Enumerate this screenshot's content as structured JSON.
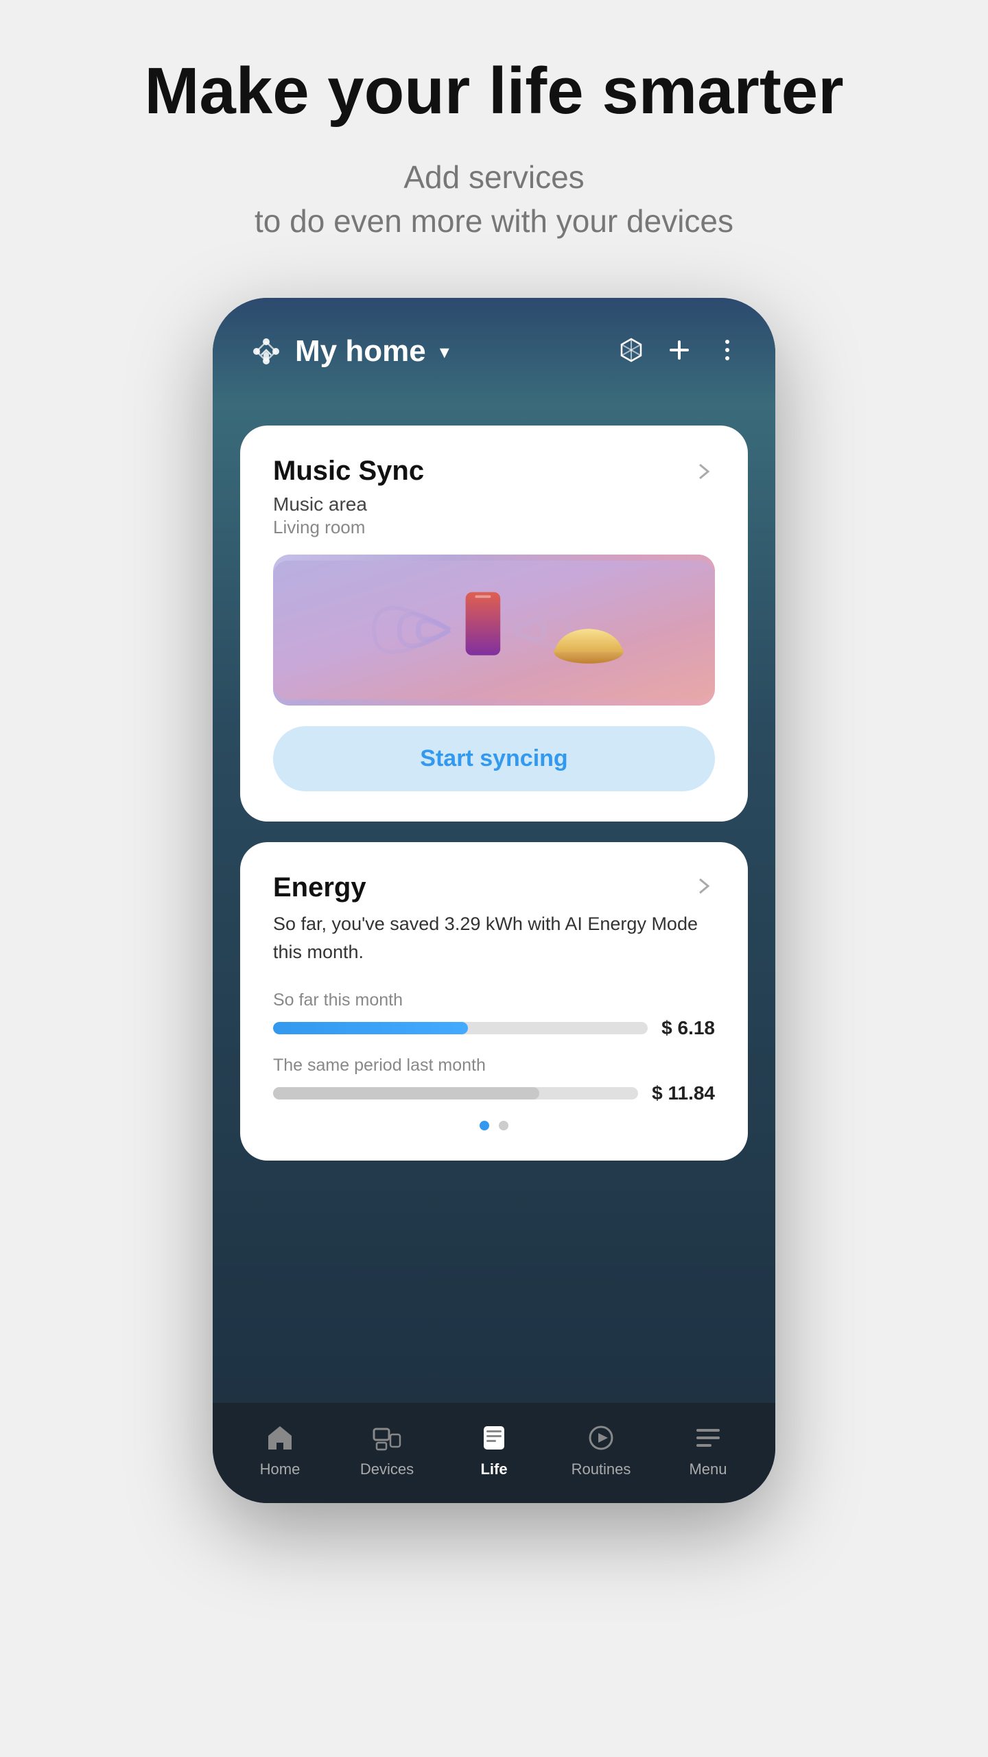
{
  "hero": {
    "title": "Make your life smarter",
    "subtitle_line1": "Add services",
    "subtitle_line2": "to do even more with your devices"
  },
  "phone": {
    "header": {
      "home_label": "My home",
      "chevron": "▾"
    },
    "music_card": {
      "title": "Music Sync",
      "subtitle": "Music area",
      "location": "Living room",
      "cta": "Start syncing"
    },
    "energy_card": {
      "title": "Energy",
      "description": "So far, you've saved 3.29 kWh with AI Energy Mode this month.",
      "this_month_label": "So far this month",
      "this_month_amount": "$ 6.18",
      "this_month_bar_percent": 52,
      "last_month_label": "The same period last month",
      "last_month_amount": "$ 11.84",
      "last_month_bar_percent": 73
    },
    "nav": {
      "items": [
        {
          "label": "Home",
          "icon": "home-icon",
          "active": false
        },
        {
          "label": "Devices",
          "icon": "devices-icon",
          "active": false
        },
        {
          "label": "Life",
          "icon": "life-icon",
          "active": true
        },
        {
          "label": "Routines",
          "icon": "routines-icon",
          "active": false
        },
        {
          "label": "Menu",
          "icon": "menu-icon",
          "active": false
        }
      ]
    }
  }
}
